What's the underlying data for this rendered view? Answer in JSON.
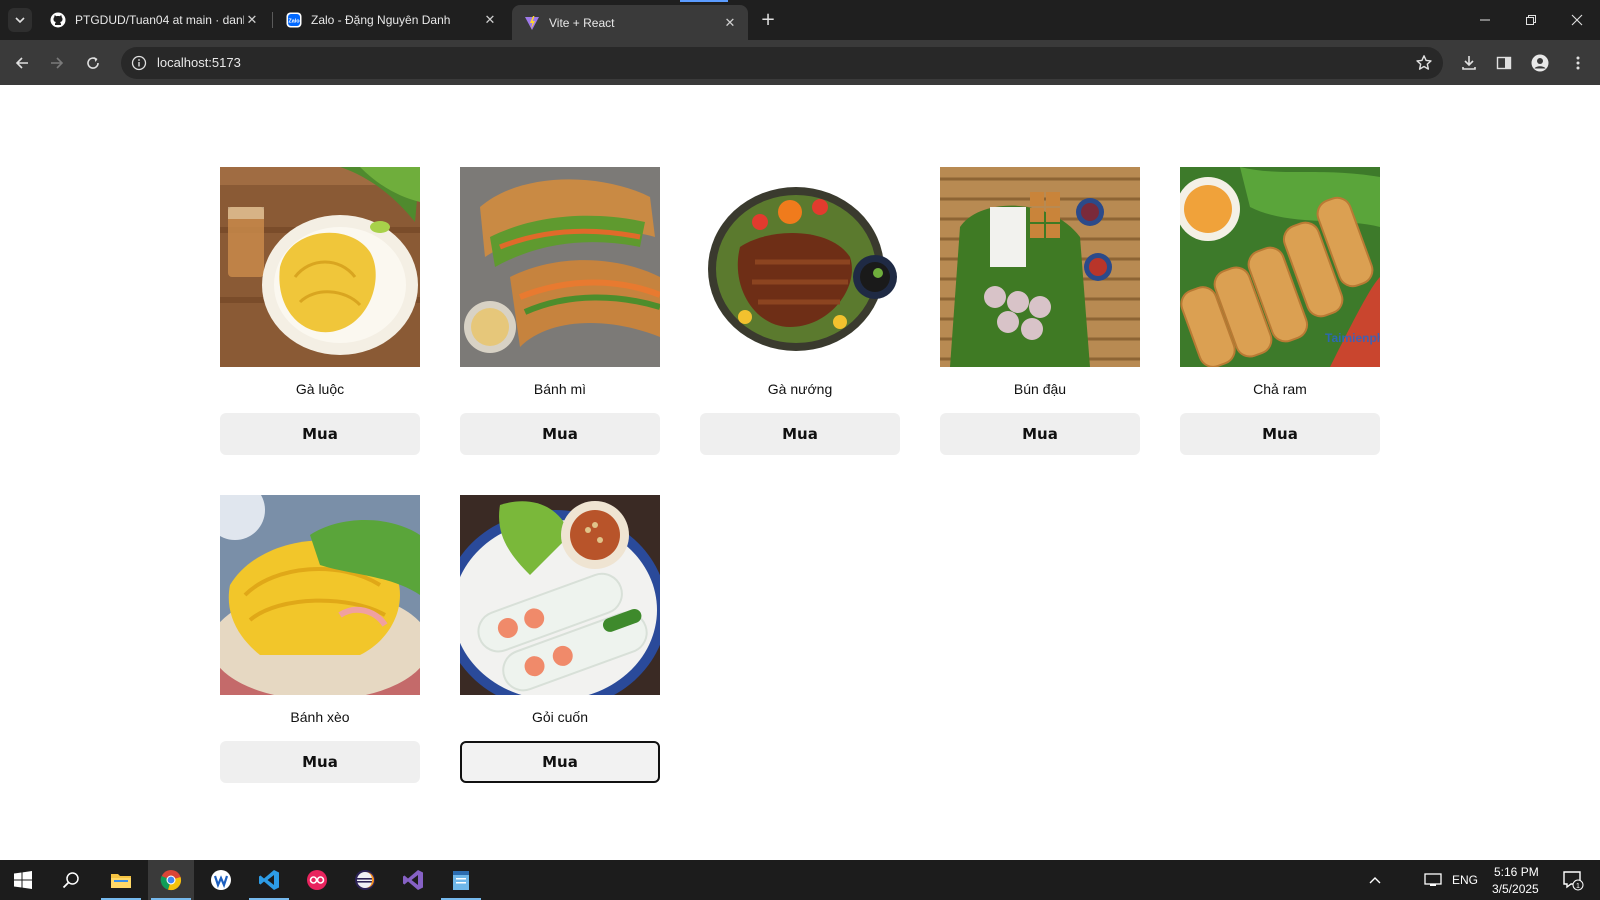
{
  "browser": {
    "tabs": [
      {
        "title": "PTGDUD/Tuan04 at main · danh",
        "favicon": "github-icon"
      },
      {
        "title": "Zalo - Đặng Nguyên Danh",
        "favicon": "zalo-icon"
      },
      {
        "title": "Vite + React",
        "favicon": "vite-icon",
        "active": true
      }
    ],
    "url": "localhost:5173"
  },
  "page": {
    "products": [
      {
        "name": "Gà luộc",
        "button": "Mua"
      },
      {
        "name": "Bánh mì",
        "button": "Mua"
      },
      {
        "name": "Gà nướng",
        "button": "Mua"
      },
      {
        "name": "Bún đậu",
        "button": "Mua"
      },
      {
        "name": "Chả ram",
        "button": "Mua",
        "watermark": "Taimienphi.vn"
      },
      {
        "name": "Bánh xèo",
        "button": "Mua"
      },
      {
        "name": "Gỏi cuốn",
        "button": "Mua",
        "focused": true
      }
    ]
  },
  "taskbar": {
    "apps": [
      "windows-start-icon",
      "search-icon",
      "file-explorer-icon",
      "chrome-icon",
      "app-icon",
      "vscode-icon",
      "app-icon",
      "eclipse-icon",
      "visual-studio-icon",
      "notepad-icon"
    ],
    "language": "ENG",
    "time": "5:16 PM",
    "date": "3/5/2025",
    "notification_count": "1"
  }
}
